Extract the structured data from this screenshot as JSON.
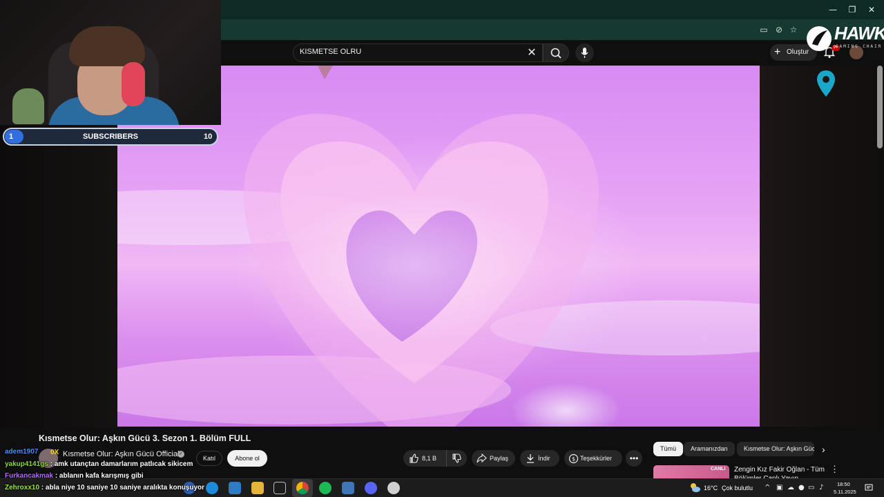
{
  "window": {
    "minimize": "—",
    "restore": "❐",
    "close": "✕"
  },
  "browser": {
    "icons": [
      "cast-icon",
      "eye-off-icon",
      "star-icon"
    ]
  },
  "header": {
    "search_value": "KISMETSE OLRU",
    "create_label": "Oluştur",
    "notification_badge": "9+"
  },
  "overlay": {
    "hawk_brand": "HAWK",
    "hawk_tagline": "GAMING CHAIR",
    "subscribers": {
      "current": "1",
      "label": "SUBSCRIBERS",
      "goal": "10",
      "progress": 0.1
    }
  },
  "video": {
    "title": "Kısmetse Olur: Aşkın Gücü 3. Sezon 1. Bölüm FULL",
    "channel": "Kısmetse Olur: Aşkın Gücü Official",
    "join_label": "Katıl",
    "subscribe_label": "Abone ol",
    "likes": "8,1 B",
    "share_label": "Paylaş",
    "download_label": "İndir",
    "thanks_label": "Teşekkürler",
    "more_label": "•••"
  },
  "chips": [
    "Tümü",
    "Aramanızdan",
    "Kısmetse Olur: Aşkın Gücü"
  ],
  "recommendation": {
    "badge": "CANLI",
    "title": "Zengin Kız Fakir Oğlan - Tüm Bölümler Canlı Yayın"
  },
  "chat": [
    {
      "user": "adem1907",
      "message": "",
      "badge": "0X"
    },
    {
      "user": "yakup4141gs",
      "message": " : amk utançtan damarlarım patlıcak sikicem"
    },
    {
      "user": "Furkancakmak",
      "message": " : ablanın kafa karışmış gibi"
    },
    {
      "user": "Zehroxx10",
      "message": " : abla niye 10 saniye 10 saniye aralıkta konuşuyor"
    }
  ],
  "taskbar": {
    "weather_temp": "16°C",
    "weather_desc": "Çok bulutlu",
    "time": "18:50",
    "date": "5.11.2025",
    "tray_chevron": "^"
  },
  "colors": {
    "accent_blue": "#2f6fe0",
    "video_pink": "#e7a6f5",
    "chat_user": "#4c8dff"
  }
}
